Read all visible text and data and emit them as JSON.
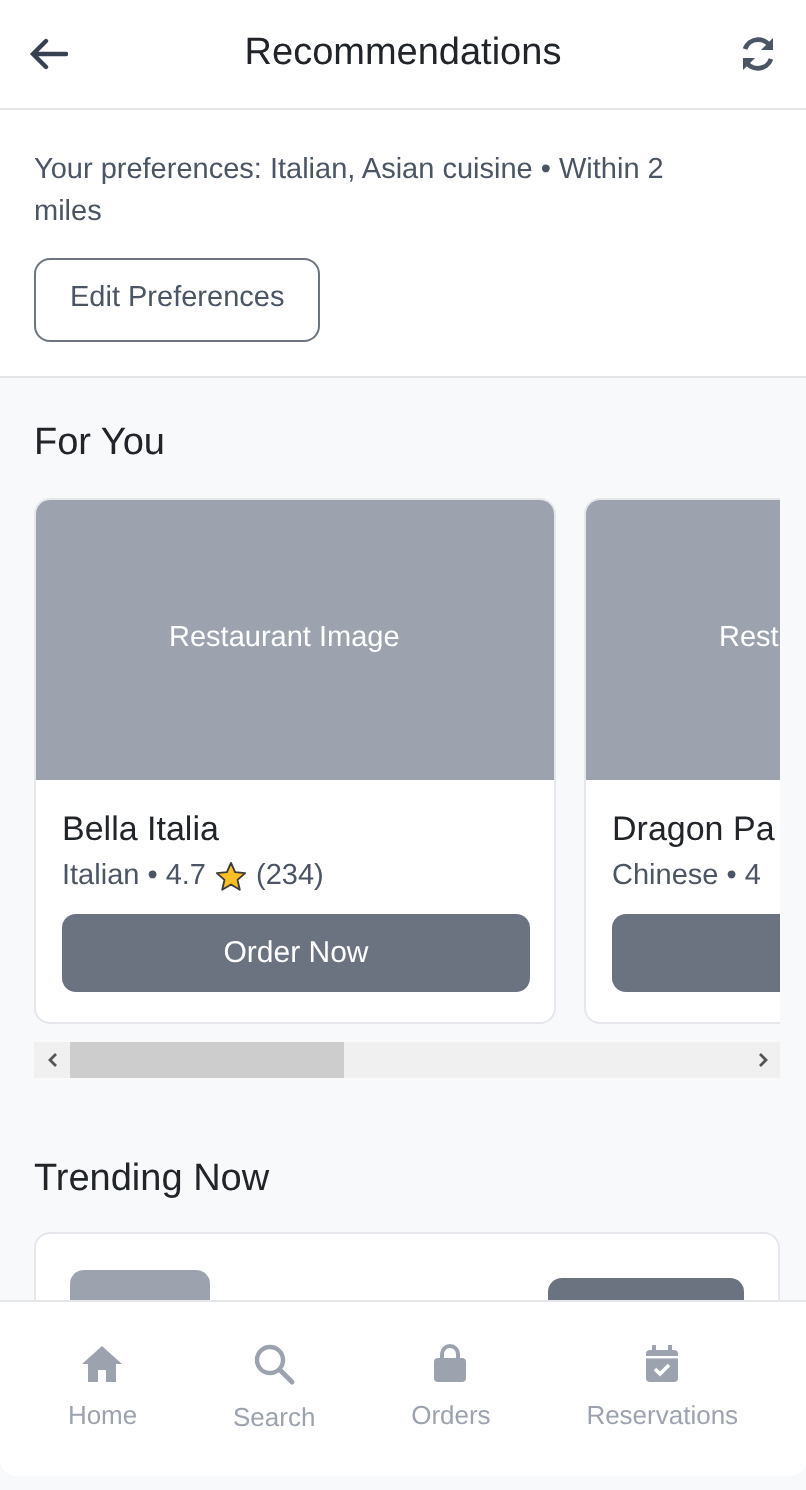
{
  "header": {
    "title": "Recommendations"
  },
  "preferences": {
    "text": "Your preferences: Italian, Asian cuisine • Within 2 miles",
    "button": "Edit Preferences"
  },
  "for_you": {
    "title": "For You",
    "cards": [
      {
        "image_label": "Restaurant Image",
        "name": "Bella Italia",
        "cuisine": "Italian •",
        "rating": "4.7",
        "reviews": "(234)",
        "button": "Order Now"
      },
      {
        "image_label": "Rest",
        "name": "Dragon Pa",
        "cuisine": "Chinese • 4"
      }
    ]
  },
  "trending": {
    "title": "Trending Now"
  },
  "bottom_nav": [
    {
      "label": "Home"
    },
    {
      "label": "Search"
    },
    {
      "label": "Orders"
    },
    {
      "label": "Reservations"
    }
  ]
}
